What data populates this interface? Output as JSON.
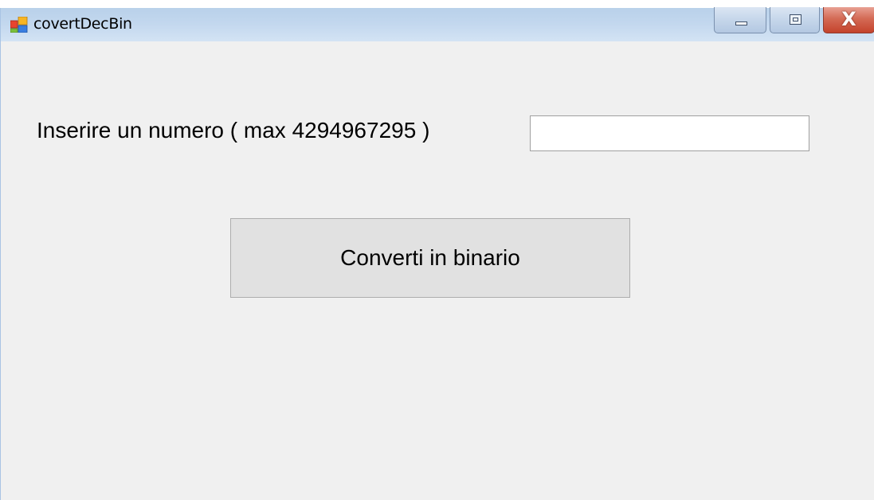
{
  "window": {
    "title": "covertDecBin",
    "icon": "windows-form-icon",
    "controls": {
      "minimize_icon": "minimize-icon",
      "maximize_icon": "maximize-icon",
      "close_glyph": "X"
    }
  },
  "form": {
    "label": "Inserire un numero ( max 4294967295 )",
    "number_input": {
      "value": "",
      "placeholder": ""
    },
    "convert_button_label": "Converti in binario"
  },
  "colors": {
    "form_background": "#f0f0f0",
    "titlebar": "#c2d7ee",
    "close_button": "#c4432c",
    "button_face": "#e1e1e1"
  }
}
